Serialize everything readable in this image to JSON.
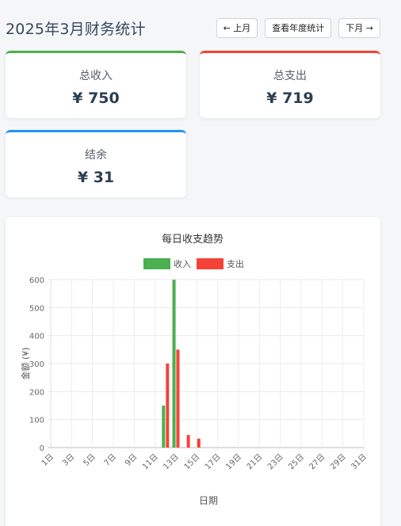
{
  "header": {
    "title": "2025年3月财务统计",
    "prev_label": "← 上月",
    "year_label": "查看年度统计",
    "next_label": "下月 →"
  },
  "summary": {
    "income": {
      "label": "总收入",
      "value": "¥ 750"
    },
    "expense": {
      "label": "总支出",
      "value": "¥ 719"
    },
    "balance": {
      "label": "结余",
      "value": "¥ 31"
    }
  },
  "colors": {
    "income": "#4caf50",
    "expense": "#f44336",
    "balance": "#2196f3"
  },
  "chart_data": {
    "type": "bar",
    "title": "每日收支趋势",
    "xlabel": "日期",
    "ylabel": "金额 (¥)",
    "ylim": [
      0,
      600
    ],
    "yticks": [
      0,
      100,
      200,
      300,
      400,
      500,
      600
    ],
    "x_tick_labels": [
      "1日",
      "3日",
      "5日",
      "7日",
      "9日",
      "11日",
      "13日",
      "15日",
      "17日",
      "19日",
      "21日",
      "23日",
      "25日",
      "27日",
      "29日",
      "31日"
    ],
    "categories": [
      "1日",
      "2日",
      "3日",
      "4日",
      "5日",
      "6日",
      "7日",
      "8日",
      "9日",
      "10日",
      "11日",
      "12日",
      "13日",
      "14日",
      "15日",
      "16日",
      "17日",
      "18日",
      "19日",
      "20日",
      "21日",
      "22日",
      "23日",
      "24日",
      "25日",
      "26日",
      "27日",
      "28日",
      "29日",
      "30日",
      "31日"
    ],
    "series": [
      {
        "name": "收入",
        "color": "#4caf50",
        "values": [
          0,
          0,
          0,
          0,
          0,
          0,
          0,
          0,
          0,
          0,
          0,
          150,
          600,
          0,
          0,
          0,
          0,
          0,
          0,
          0,
          0,
          0,
          0,
          0,
          0,
          0,
          0,
          0,
          0,
          0,
          0
        ]
      },
      {
        "name": "支出",
        "color": "#f44336",
        "values": [
          0,
          0,
          0,
          0,
          0,
          0,
          0,
          0,
          0,
          0,
          0,
          300,
          350,
          45,
          32,
          0,
          0,
          0,
          0,
          0,
          0,
          0,
          0,
          0,
          0,
          0,
          0,
          0,
          0,
          0,
          0
        ]
      }
    ],
    "grid": true,
    "legend": "top"
  }
}
